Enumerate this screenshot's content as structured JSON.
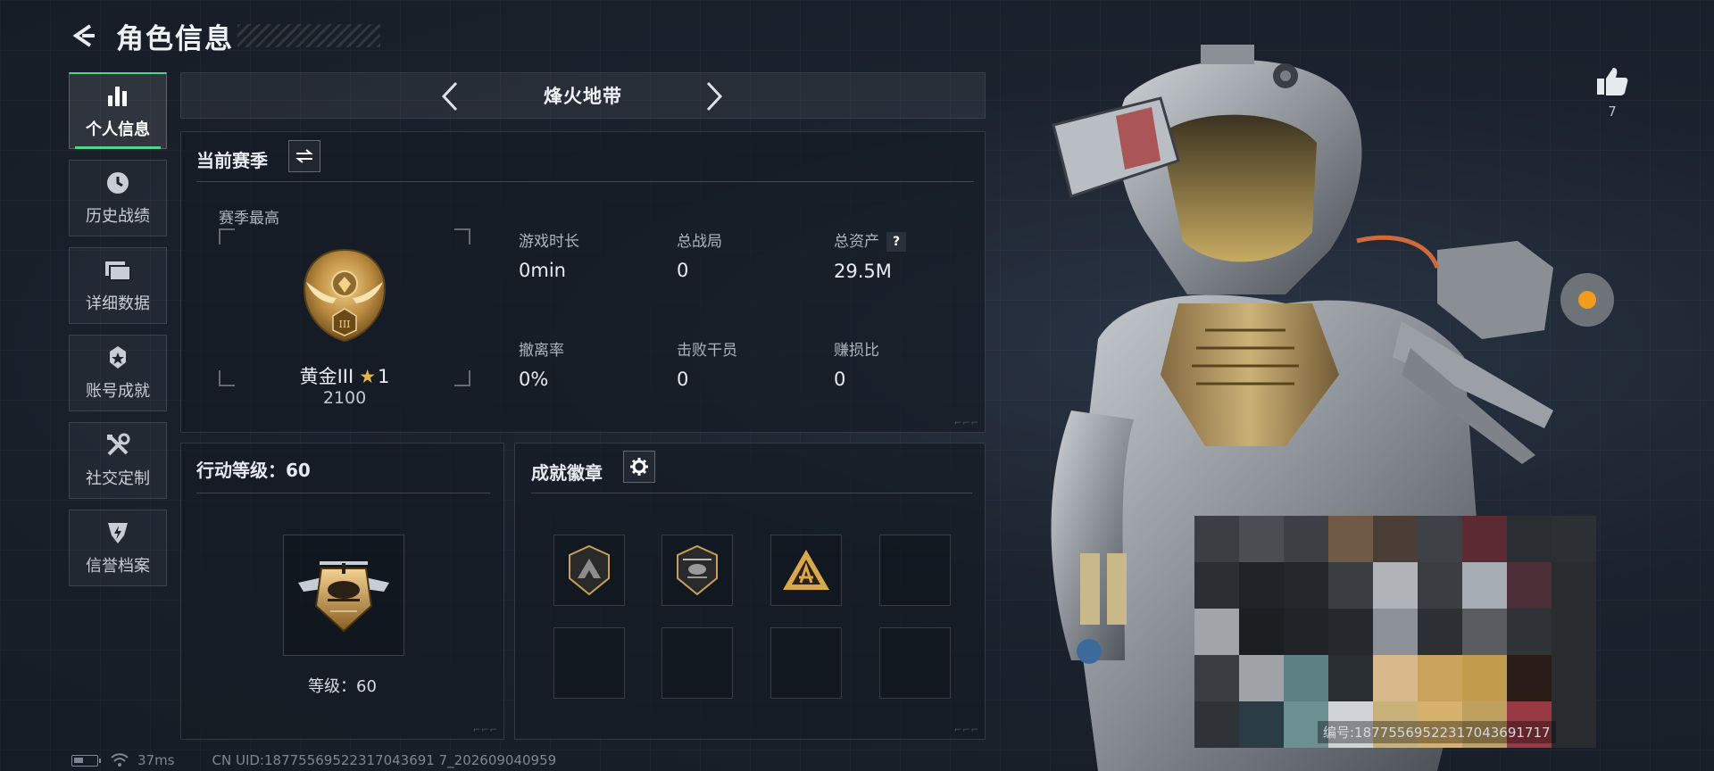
{
  "header": {
    "title": "角色信息"
  },
  "sidebar": {
    "items": [
      {
        "label": "个人信息",
        "icon": "bar-chart-icon",
        "active": true
      },
      {
        "label": "历史战绩",
        "icon": "clock-icon",
        "active": false
      },
      {
        "label": "详细数据",
        "icon": "folder-icon",
        "active": false
      },
      {
        "label": "账号成就",
        "icon": "medal-icon",
        "active": false
      },
      {
        "label": "社交定制",
        "icon": "tools-icon",
        "active": false
      },
      {
        "label": "信誉档案",
        "icon": "shield-bolt-icon",
        "active": false
      }
    ]
  },
  "mode": {
    "title": "烽火地带"
  },
  "season": {
    "title": "当前赛季",
    "subtitle": "赛季最高",
    "rank_name": "黄金III",
    "rank_stars": "1",
    "rank_score": "2100",
    "rank_numeral": "III",
    "stats": [
      {
        "label": "游戏时长",
        "value": "0min"
      },
      {
        "label": "总战局",
        "value": "0"
      },
      {
        "label": "总资产",
        "value": "29.5M",
        "help": "?"
      },
      {
        "label": "撤离率",
        "value": "0%"
      },
      {
        "label": "击败干员",
        "value": "0"
      },
      {
        "label": "赚损比",
        "value": "0"
      }
    ]
  },
  "action_level": {
    "title": "行动等级：60",
    "level_text": "等级：60"
  },
  "achievements": {
    "title": "成就徽章",
    "slots": [
      {
        "badge": "mountain-badge-icon"
      },
      {
        "badge": "helicopter-badge-icon"
      },
      {
        "badge": "triangle-emblem-icon"
      },
      {
        "badge": ""
      },
      {
        "badge": ""
      },
      {
        "badge": ""
      },
      {
        "badge": ""
      },
      {
        "badge": ""
      }
    ]
  },
  "likes": {
    "count": "7"
  },
  "character": {
    "id_text": "编号:18775569522317043691717"
  },
  "status_bar": {
    "ping": "37ms",
    "uid": "CN UID:18775569522317043691 7_202609040959"
  },
  "colors": {
    "accent": "#4fd68b",
    "gold": "#c9a05a",
    "panel_border": "#3a4350"
  }
}
